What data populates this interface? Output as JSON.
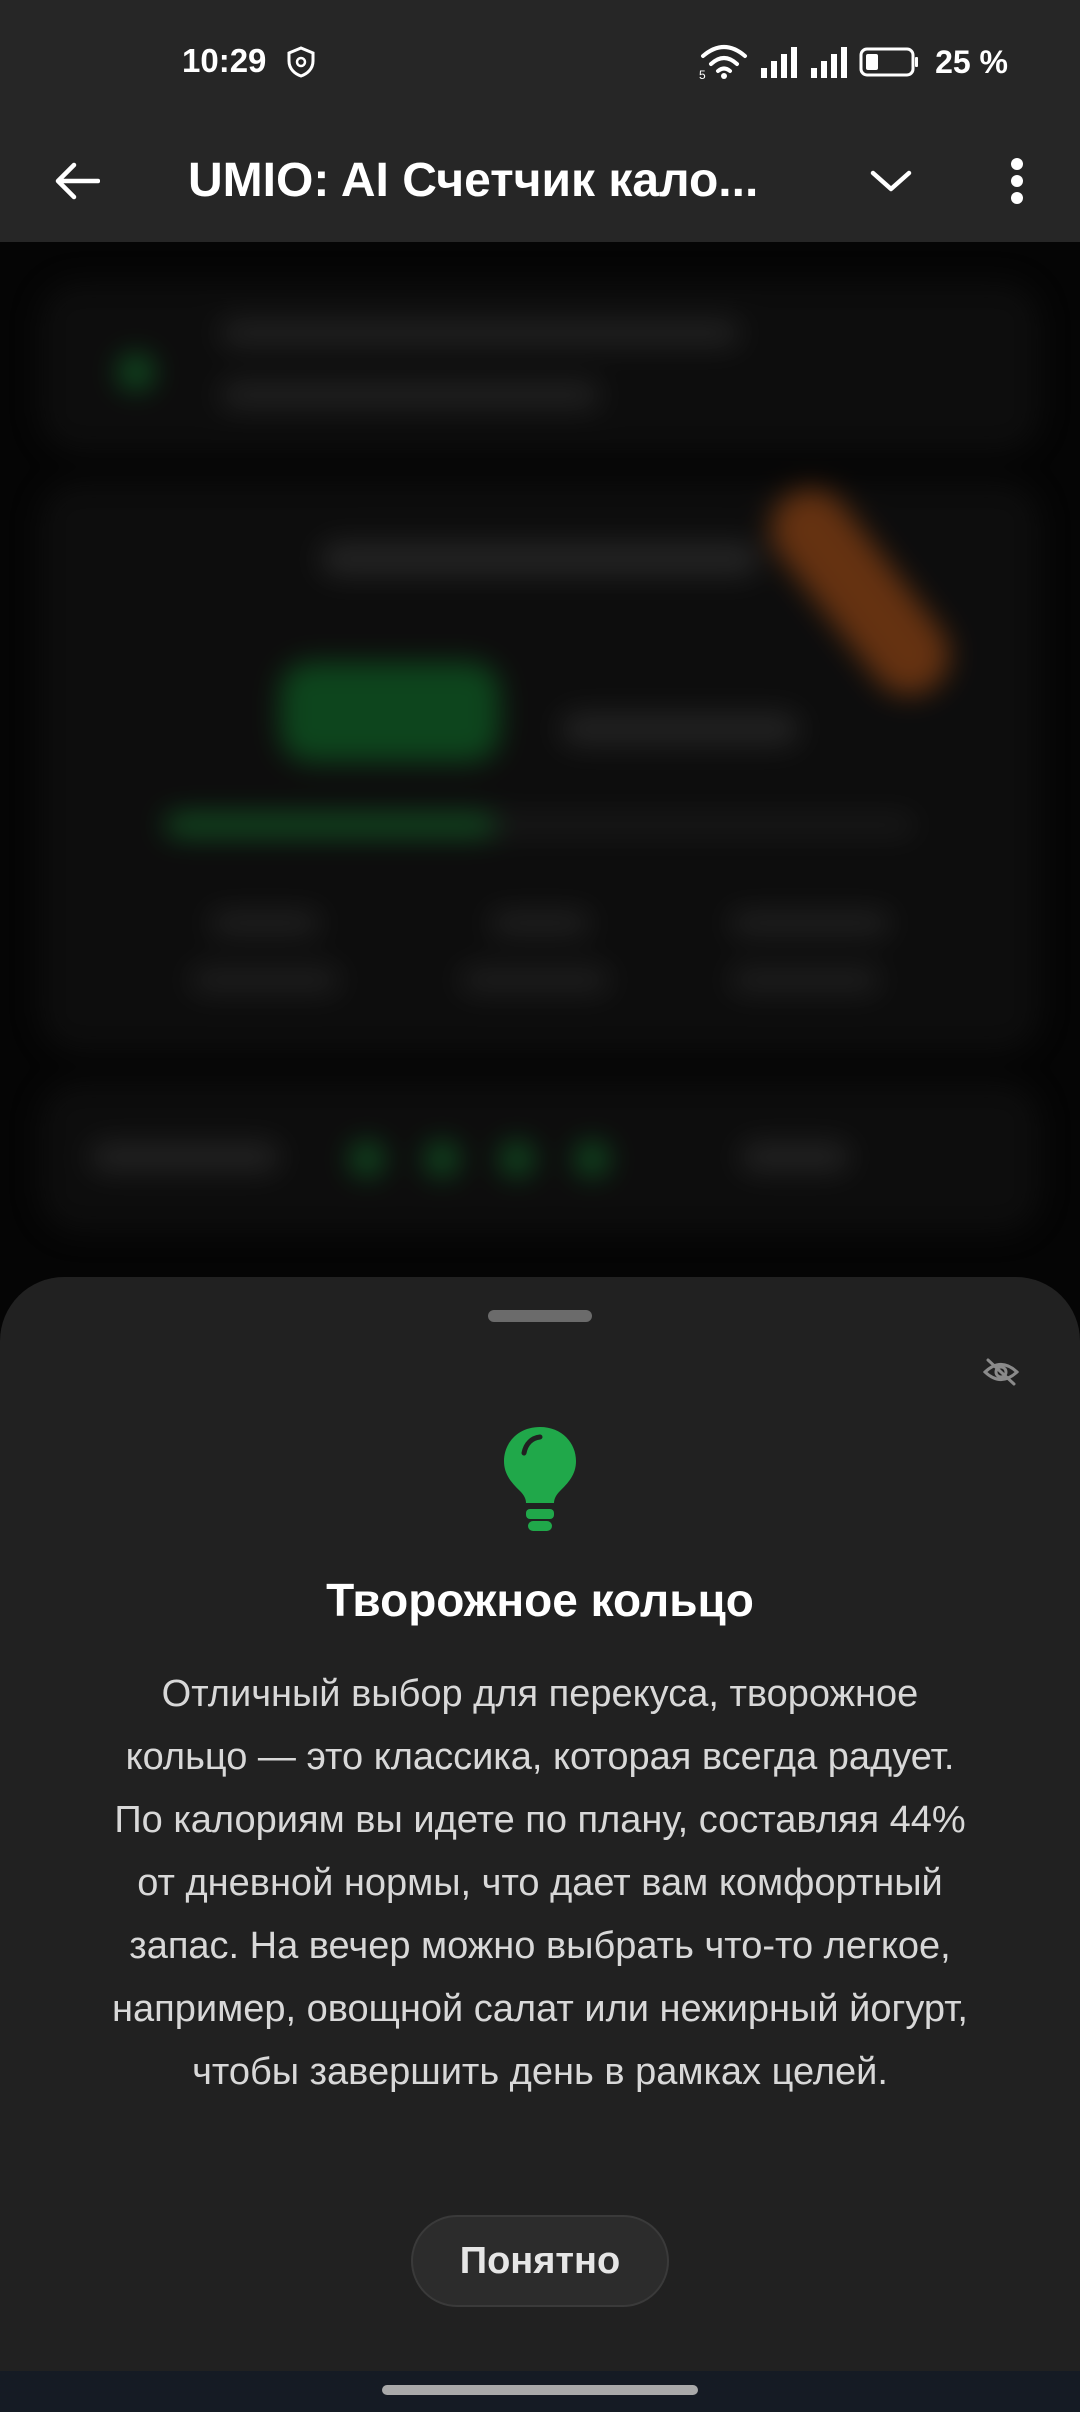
{
  "status_bar": {
    "time": "10:29",
    "battery": "25 %",
    "icons": [
      "shield-icon",
      "wifi-icon",
      "signal-icon",
      "signal-icon",
      "battery-icon"
    ]
  },
  "app_bar": {
    "title": "UMIO: AI Счетчик кало...",
    "icons": [
      "back-arrow-icon",
      "chevron-down-icon",
      "more-vert-icon"
    ]
  },
  "sheet": {
    "title": "Творожное кольцо",
    "body": "Отличный выбор для перекуса, творожное кольцо — это классика, которая всегда радует. По калориям вы идете по плану, составляя 44% от дневной нормы, что дает вам комфортный запас. На вечер можно выбрать что-то легкое, например, овощной салат или нежирный йогурт, чтобы завершить день в рамках целей.",
    "ok_label": "Понятно",
    "icons": [
      "eye-off-icon",
      "lightbulb-icon"
    ],
    "accent_color": "#20a84a"
  },
  "colors": {
    "background": "#151515",
    "sheet": "#212121",
    "app_bar": "#262626"
  }
}
